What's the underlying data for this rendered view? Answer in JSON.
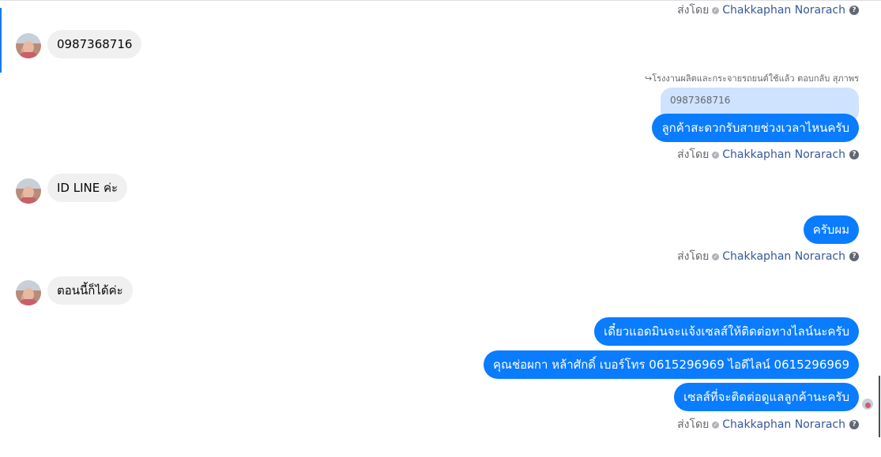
{
  "messages": {
    "sender_name": "Chakkaphan Norarach",
    "sent_by_label": "ส่งโดย",
    "incoming": [
      {
        "text": "0987368716"
      },
      {
        "text": "ID LINE ค่ะ"
      },
      {
        "text": "ตอนนี้ก็ได้ค่ะ"
      }
    ],
    "reply_note": "↪โรงงานผลิตและกระจายรถยนต์ใช้แล้ว ตอบกลับ สุภาพร",
    "quoted_text": "0987368716",
    "outgoing": [
      {
        "text": "ลูกค้าสะดวกรับสายช่วงเวลาไหนครับ"
      },
      {
        "text": "ครับผม"
      },
      {
        "text": "เดี๋ยวแอดมินจะแจ้งเซลส์ให้ติดต่อทางไลน์นะครับ"
      },
      {
        "text": "คุณช่อผกา หล้าศักดิ์       เบอร์โทร 0615296969  ไอดีไลน์ 0615296969"
      },
      {
        "text": "เซลส์ที่จะติดต่อดูแลลูกค้านะครับ"
      }
    ]
  },
  "icons": {
    "verified": "check-circle-icon",
    "help": "question-circle-icon"
  },
  "colors": {
    "outgoing_bubble": "#0a7cff",
    "incoming_bubble": "#f0f0f0",
    "quoted_bubble": "#cfe3ff",
    "sender_link": "#385898"
  }
}
